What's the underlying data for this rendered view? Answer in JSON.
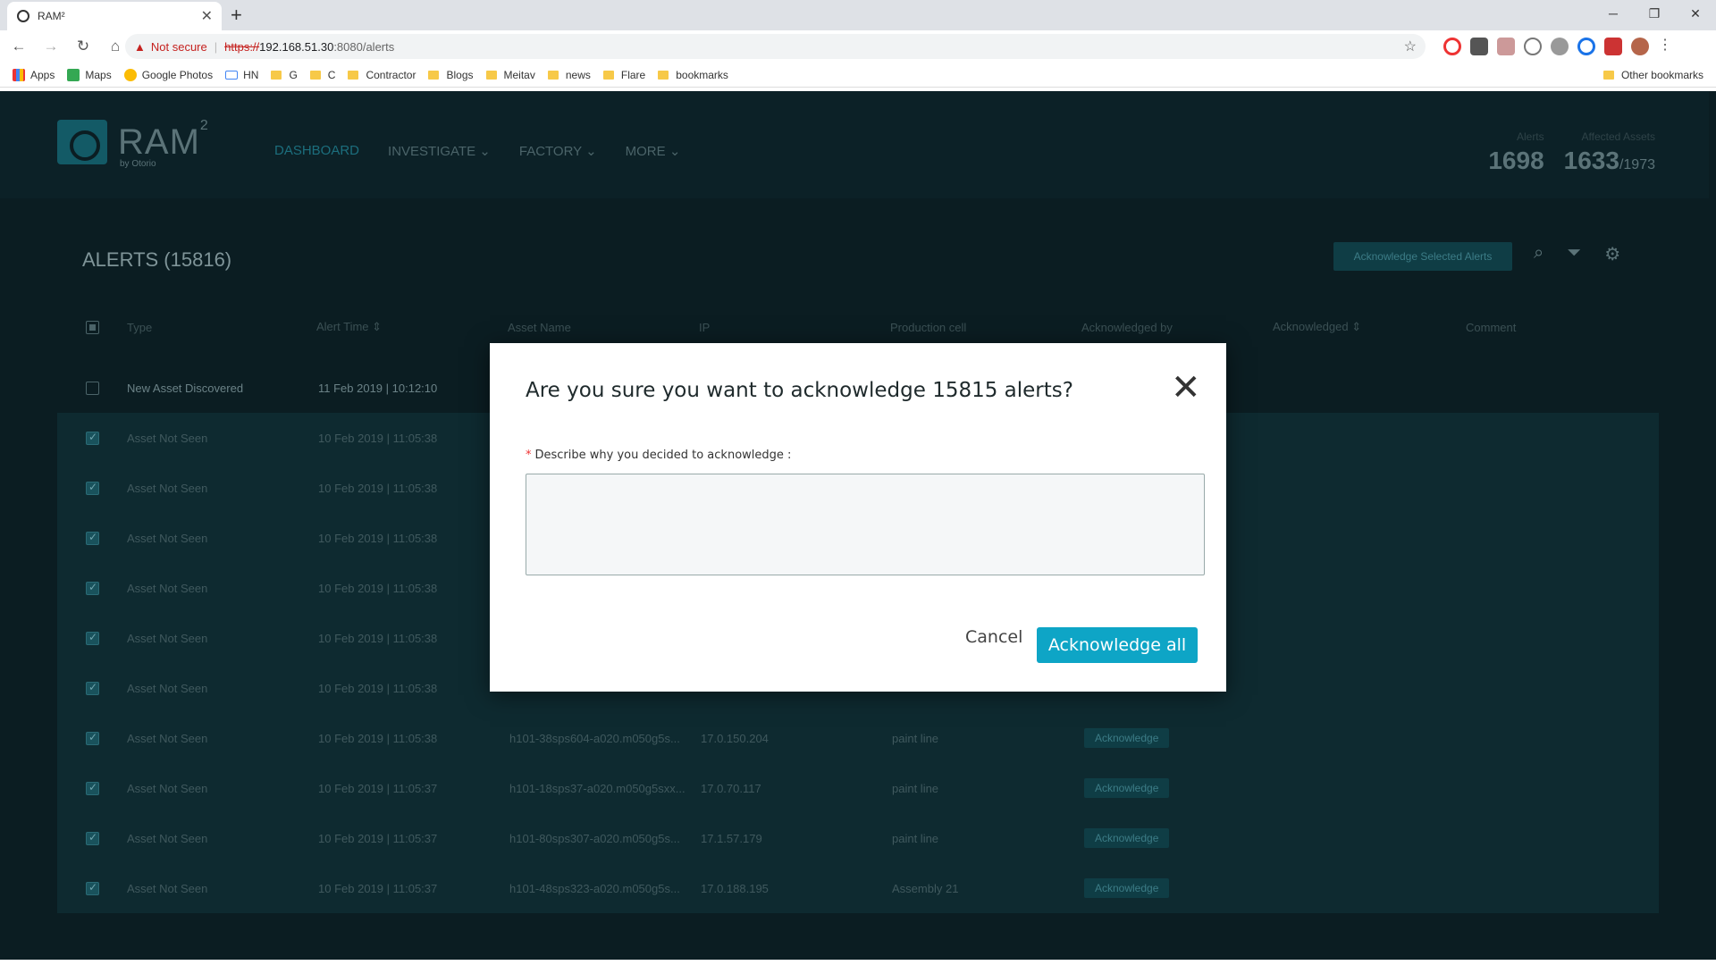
{
  "browser": {
    "tab_title": "RAM²",
    "url_warning": "Not secure",
    "url_scheme": "https://",
    "url_host": "192.168.51.30",
    "url_path": ":8080/alerts",
    "bookmarks": [
      "Apps",
      "Maps",
      "Google Photos",
      "HN",
      "G",
      "C",
      "Contractor",
      "Blogs",
      "Meitav",
      "news",
      "Flare",
      "bookmarks"
    ],
    "other_bookmarks": "Other bookmarks"
  },
  "app": {
    "logo_name": "RAM",
    "logo_sup": "2",
    "logo_by": "by Otorio",
    "nav": {
      "dashboard": "DASHBOARD",
      "investigate": "INVESTIGATE",
      "factory": "FACTORY",
      "more": "MORE"
    },
    "stats": {
      "alerts_label": "Alerts",
      "alerts_value": "1698",
      "assets_label": "Affected Assets",
      "assets_value": "1633",
      "assets_total": "/1973"
    }
  },
  "alerts": {
    "title": "ALERTS (15816)",
    "ack_selected_label": "Acknowledge Selected Alerts",
    "columns": {
      "type": "Type",
      "time": "Alert Time",
      "asset": "Asset Name",
      "ip": "IP",
      "cell": "Production cell",
      "by": "Acknowledged by",
      "acked": "Acknowledged",
      "comment": "Comment"
    },
    "ack_button_label": "Acknowledge",
    "rows": [
      {
        "type": "New Asset Discovered",
        "time": "11 Feb 2019 | 10:12:10",
        "asset": "",
        "ip": "",
        "cell": "",
        "selected": false
      },
      {
        "type": "Asset Not Seen",
        "time": "10 Feb 2019 | 11:05:38",
        "asset": "",
        "ip": "",
        "cell": "",
        "selected": true
      },
      {
        "type": "Asset Not Seen",
        "time": "10 Feb 2019 | 11:05:38",
        "asset": "",
        "ip": "",
        "cell": "",
        "selected": true
      },
      {
        "type": "Asset Not Seen",
        "time": "10 Feb 2019 | 11:05:38",
        "asset": "",
        "ip": "",
        "cell": "",
        "selected": true
      },
      {
        "type": "Asset Not Seen",
        "time": "10 Feb 2019 | 11:05:38",
        "asset": "",
        "ip": "",
        "cell": "",
        "selected": true
      },
      {
        "type": "Asset Not Seen",
        "time": "10 Feb 2019 | 11:05:38",
        "asset": "",
        "ip": "",
        "cell": "",
        "selected": true
      },
      {
        "type": "Asset Not Seen",
        "time": "10 Feb 2019 | 11:05:38",
        "asset": "",
        "ip": "",
        "cell": "",
        "selected": true
      },
      {
        "type": "Asset Not Seen",
        "time": "10 Feb 2019 | 11:05:38",
        "asset": "h101-38sps604-a020.m050g5s...",
        "ip": "17.0.150.204",
        "cell": "paint line",
        "selected": true
      },
      {
        "type": "Asset Not Seen",
        "time": "10 Feb 2019 | 11:05:37",
        "asset": "h101-18sps37-a020.m050g5sxx...",
        "ip": "17.0.70.117",
        "cell": "paint line",
        "selected": true
      },
      {
        "type": "Asset Not Seen",
        "time": "10 Feb 2019 | 11:05:37",
        "asset": "h101-80sps307-a020.m050g5s...",
        "ip": "17.1.57.179",
        "cell": "paint line",
        "selected": true
      },
      {
        "type": "Asset Not Seen",
        "time": "10 Feb 2019 | 11:05:37",
        "asset": "h101-48sps323-a020.m050g5s...",
        "ip": "17.0.188.195",
        "cell": "Assembly 21",
        "selected": true
      }
    ]
  },
  "modal": {
    "title": "Are you sure you want to acknowledge 15815 alerts?",
    "required_mark": "*",
    "label": "Describe why you decided to acknowledge :",
    "textarea_value": "",
    "cancel_label": "Cancel",
    "ack_all_label": "Acknowledge all",
    "accent_color": "#0ea5c6"
  }
}
